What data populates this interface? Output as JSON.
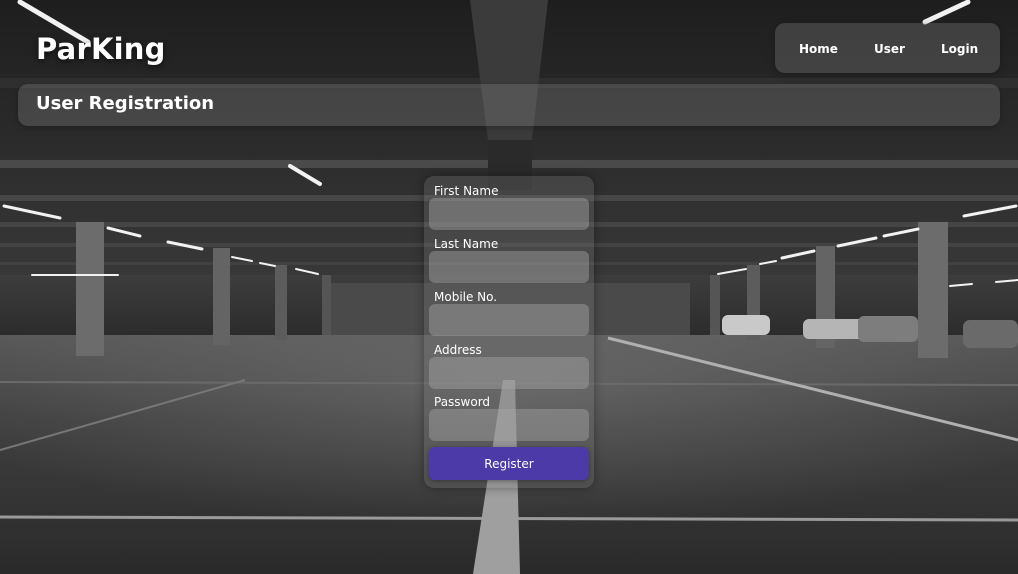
{
  "header": {
    "logo": "ParKing",
    "nav": [
      {
        "label": "Home"
      },
      {
        "label": "User"
      },
      {
        "label": "Login"
      }
    ]
  },
  "page": {
    "title": "User Registration"
  },
  "form": {
    "fields": [
      {
        "label": "First Name",
        "value": ""
      },
      {
        "label": "Last Name",
        "value": ""
      },
      {
        "label": "Mobile No.",
        "value": ""
      },
      {
        "label": "Address",
        "value": ""
      },
      {
        "label": "Password",
        "value": ""
      }
    ],
    "submit_label": "Register"
  },
  "colors": {
    "accent": "#4b3aa8",
    "text": "#ffffff"
  }
}
